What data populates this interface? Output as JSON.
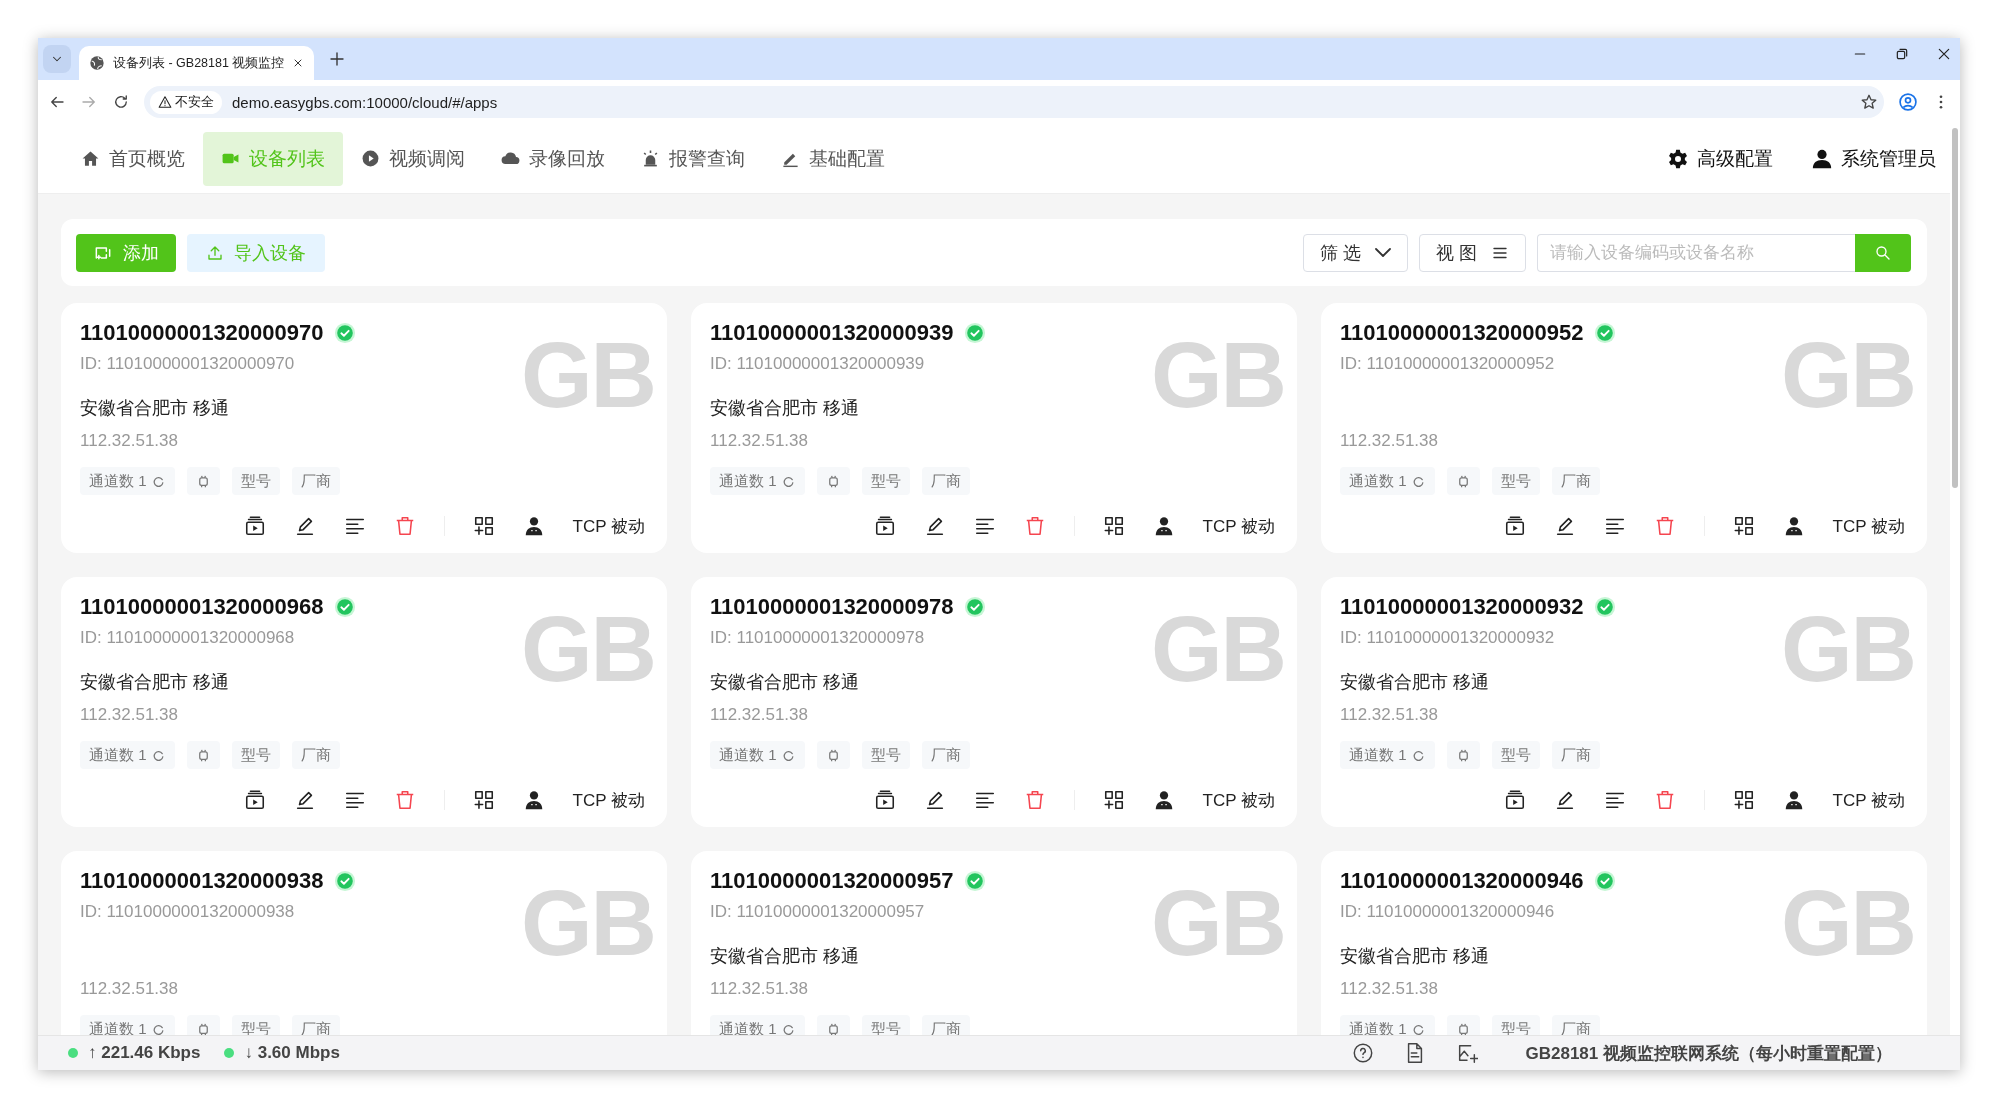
{
  "browser": {
    "tab_title": "设备列表 - GB28181 视频监控",
    "security": "不安全",
    "url": "demo.easygbs.com:10000/cloud/#/apps"
  },
  "nav": {
    "items": [
      {
        "label": "首页概览",
        "selected": false
      },
      {
        "label": "设备列表",
        "selected": true
      },
      {
        "label": "视频调阅",
        "selected": false
      },
      {
        "label": "录像回放",
        "selected": false
      },
      {
        "label": "报警查询",
        "selected": false
      },
      {
        "label": "基础配置",
        "selected": false
      }
    ],
    "settings": "高级配置",
    "user": "系统管理员"
  },
  "toolbar": {
    "add": "添加",
    "import": "导入设备",
    "filter": "筛 选",
    "view": "视 图",
    "search": {
      "placeholder": "请输入设备编码或设备名称"
    }
  },
  "cards": [
    {
      "name": "11010000001320000970",
      "online": true,
      "watermark": "GB",
      "id": "ID: 11010000001320000970",
      "location": "安徽省合肥市 移通",
      "ip": "112.32.51.38",
      "channels": "通道数 1",
      "model": "型号",
      "vendor": "厂商",
      "mode": "TCP 被动"
    },
    {
      "name": "11010000001320000939",
      "online": true,
      "watermark": "GB",
      "id": "ID: 11010000001320000939",
      "location": "安徽省合肥市 移通",
      "ip": "112.32.51.38",
      "channels": "通道数 1",
      "model": "型号",
      "vendor": "厂商",
      "mode": "TCP 被动"
    },
    {
      "name": "11010000001320000952",
      "online": true,
      "watermark": "GB",
      "id": "ID: 11010000001320000952",
      "ip": "112.32.51.38",
      "channels": "通道数 1",
      "model": "型号",
      "vendor": "厂商",
      "mode": "TCP 被动"
    },
    {
      "name": "11010000001320000968",
      "online": true,
      "watermark": "GB",
      "id": "ID: 11010000001320000968",
      "location": "安徽省合肥市 移通",
      "ip": "112.32.51.38",
      "channels": "通道数 1",
      "model": "型号",
      "vendor": "厂商",
      "mode": "TCP 被动"
    },
    {
      "name": "11010000001320000978",
      "online": true,
      "watermark": "GB",
      "id": "ID: 11010000001320000978",
      "location": "安徽省合肥市 移通",
      "ip": "112.32.51.38",
      "channels": "通道数 1",
      "model": "型号",
      "vendor": "厂商",
      "mode": "TCP 被动"
    },
    {
      "name": "11010000001320000932",
      "online": true,
      "watermark": "GB",
      "id": "ID: 11010000001320000932",
      "location": "安徽省合肥市 移通",
      "ip": "112.32.51.38",
      "channels": "通道数 1",
      "model": "型号",
      "vendor": "厂商",
      "mode": "TCP 被动"
    },
    {
      "name": "11010000001320000938",
      "online": true,
      "watermark": "GB",
      "id": "ID: 11010000001320000938",
      "ip": "112.32.51.38",
      "channels": "通道数 1",
      "model": "型号",
      "vendor": "厂商"
    },
    {
      "name": "11010000001320000957",
      "online": true,
      "watermark": "GB",
      "id": "ID: 11010000001320000957",
      "location": "安徽省合肥市 移通",
      "ip": "112.32.51.38",
      "channels": "通道数 1",
      "model": "型号",
      "vendor": "厂商"
    },
    {
      "name": "11010000001320000946",
      "online": true,
      "watermark": "GB",
      "id": "ID: 11010000001320000946",
      "location": "安徽省合肥市 移通",
      "ip": "112.32.51.38",
      "channels": "通道数 1",
      "model": "型号",
      "vendor": "厂商"
    }
  ],
  "status_bar": {
    "upload": "↑ 221.46 Kbps",
    "download": "↓ 3.60 Mbps",
    "title": "GB28181 视频监控联网系统（每小时重置配置）"
  }
}
